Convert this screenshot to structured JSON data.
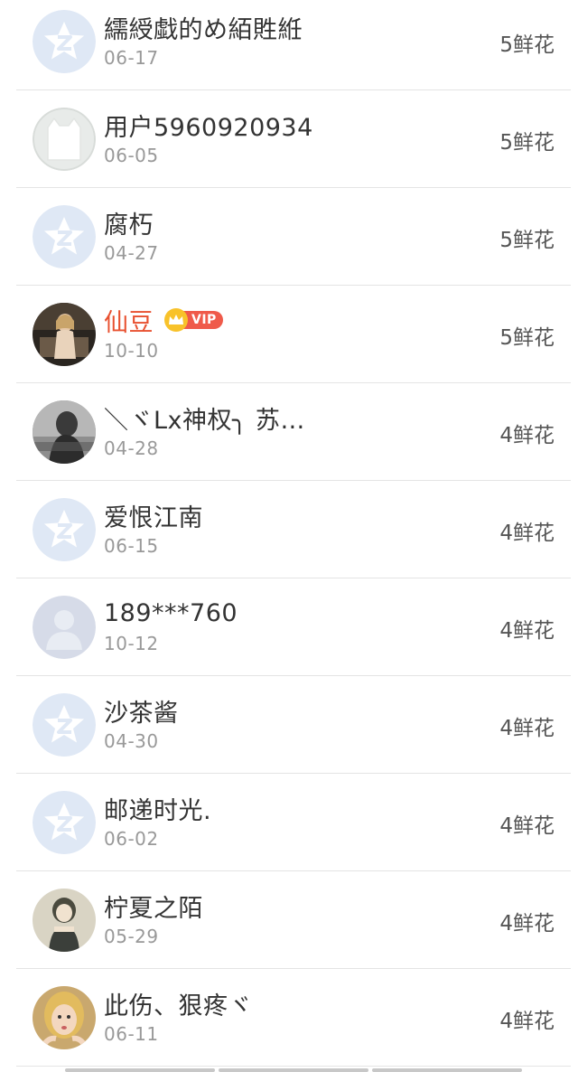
{
  "colors": {
    "name_default": "#333333",
    "name_vip": "#e8502f",
    "date": "#999999",
    "divider": "#e4e4e4",
    "vip_badge": "#ef5a4a",
    "crown": "#f8c22a"
  },
  "rows": [
    {
      "name": "繻綬戱的め絔貹絍",
      "date": "06-17",
      "flowers": "5鲜花",
      "avatar": "default-star-icon",
      "vip": false
    },
    {
      "name": "用户5960920934",
      "date": "06-05",
      "flowers": "5鲜花",
      "avatar": "cat-silhouette",
      "vip": false
    },
    {
      "name": "腐朽",
      "date": "04-27",
      "flowers": "5鲜花",
      "avatar": "default-star-icon",
      "vip": false
    },
    {
      "name": "仙豆",
      "date": "10-10",
      "flowers": "5鲜花",
      "avatar": "photo-girl",
      "vip": true,
      "vip_label": "VIP"
    },
    {
      "name": "＼ヾLx神权╮ 苏…",
      "date": "04-28",
      "flowers": "4鲜花",
      "avatar": "photo-dark",
      "vip": false
    },
    {
      "name": "爱恨江南",
      "date": "06-15",
      "flowers": "4鲜花",
      "avatar": "default-star-icon",
      "vip": false
    },
    {
      "name": "189***760",
      "date": "10-12",
      "flowers": "4鲜花",
      "avatar": "default-person",
      "vip": false
    },
    {
      "name": "沙茶酱",
      "date": "04-30",
      "flowers": "4鲜花",
      "avatar": "default-star-icon",
      "vip": false
    },
    {
      "name": "邮递时光.",
      "date": "06-02",
      "flowers": "4鲜花",
      "avatar": "default-star-icon",
      "vip": false
    },
    {
      "name": "柠夏之陌",
      "date": "05-29",
      "flowers": "4鲜花",
      "avatar": "photo-anime",
      "vip": false
    },
    {
      "name": "此伤、狠疼ヾ",
      "date": "06-11",
      "flowers": "4鲜花",
      "avatar": "photo-blonde",
      "vip": false
    }
  ]
}
